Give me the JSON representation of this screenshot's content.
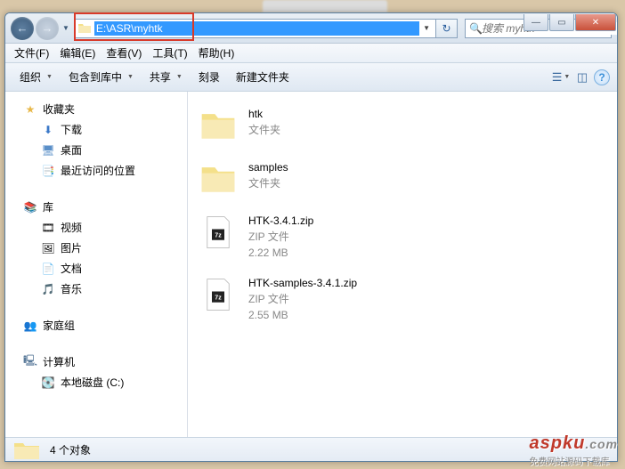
{
  "titlebar": {
    "min": "―",
    "max": "▭",
    "close": "✕"
  },
  "nav": {
    "back": "←",
    "fwd": "→",
    "path": "E:\\ASR\\myhtk",
    "refresh": "↻"
  },
  "search": {
    "placeholder": "搜索 myhtk",
    "icon": "🔍"
  },
  "menu": {
    "file": "文件(F)",
    "edit": "编辑(E)",
    "view": "查看(V)",
    "tools": "工具(T)",
    "help": "帮助(H)"
  },
  "toolbar": {
    "organize": "组织",
    "include": "包含到库中",
    "share": "共享",
    "burn": "刻录",
    "newfolder": "新建文件夹"
  },
  "sidebar": {
    "favorites": {
      "label": "收藏夹",
      "items": [
        {
          "label": "下载",
          "icon": "⬇"
        },
        {
          "label": "桌面",
          "icon": "🖥"
        },
        {
          "label": "最近访问的位置",
          "icon": "📑"
        }
      ]
    },
    "libraries": {
      "label": "库",
      "items": [
        {
          "label": "视频",
          "icon": "🎞"
        },
        {
          "label": "图片",
          "icon": "🖼"
        },
        {
          "label": "文档",
          "icon": "📄"
        },
        {
          "label": "音乐",
          "icon": "🎵"
        }
      ]
    },
    "homegroup": {
      "label": "家庭组"
    },
    "computer": {
      "label": "计算机",
      "items": [
        {
          "label": "本地磁盘 (C:)"
        }
      ]
    }
  },
  "files": [
    {
      "name": "htk",
      "type": "文件夹",
      "size": "",
      "kind": "folder"
    },
    {
      "name": "samples",
      "type": "文件夹",
      "size": "",
      "kind": "folder"
    },
    {
      "name": "HTK-3.4.1.zip",
      "type": "ZIP 文件",
      "size": "2.22 MB",
      "kind": "zip"
    },
    {
      "name": "HTK-samples-3.4.1.zip",
      "type": "ZIP 文件",
      "size": "2.55 MB",
      "kind": "zip"
    }
  ],
  "status": {
    "count": "4 个对象"
  },
  "watermark": {
    "main": "aspku",
    "suffix": ".com",
    "sub": "免费网站源码下载库"
  }
}
